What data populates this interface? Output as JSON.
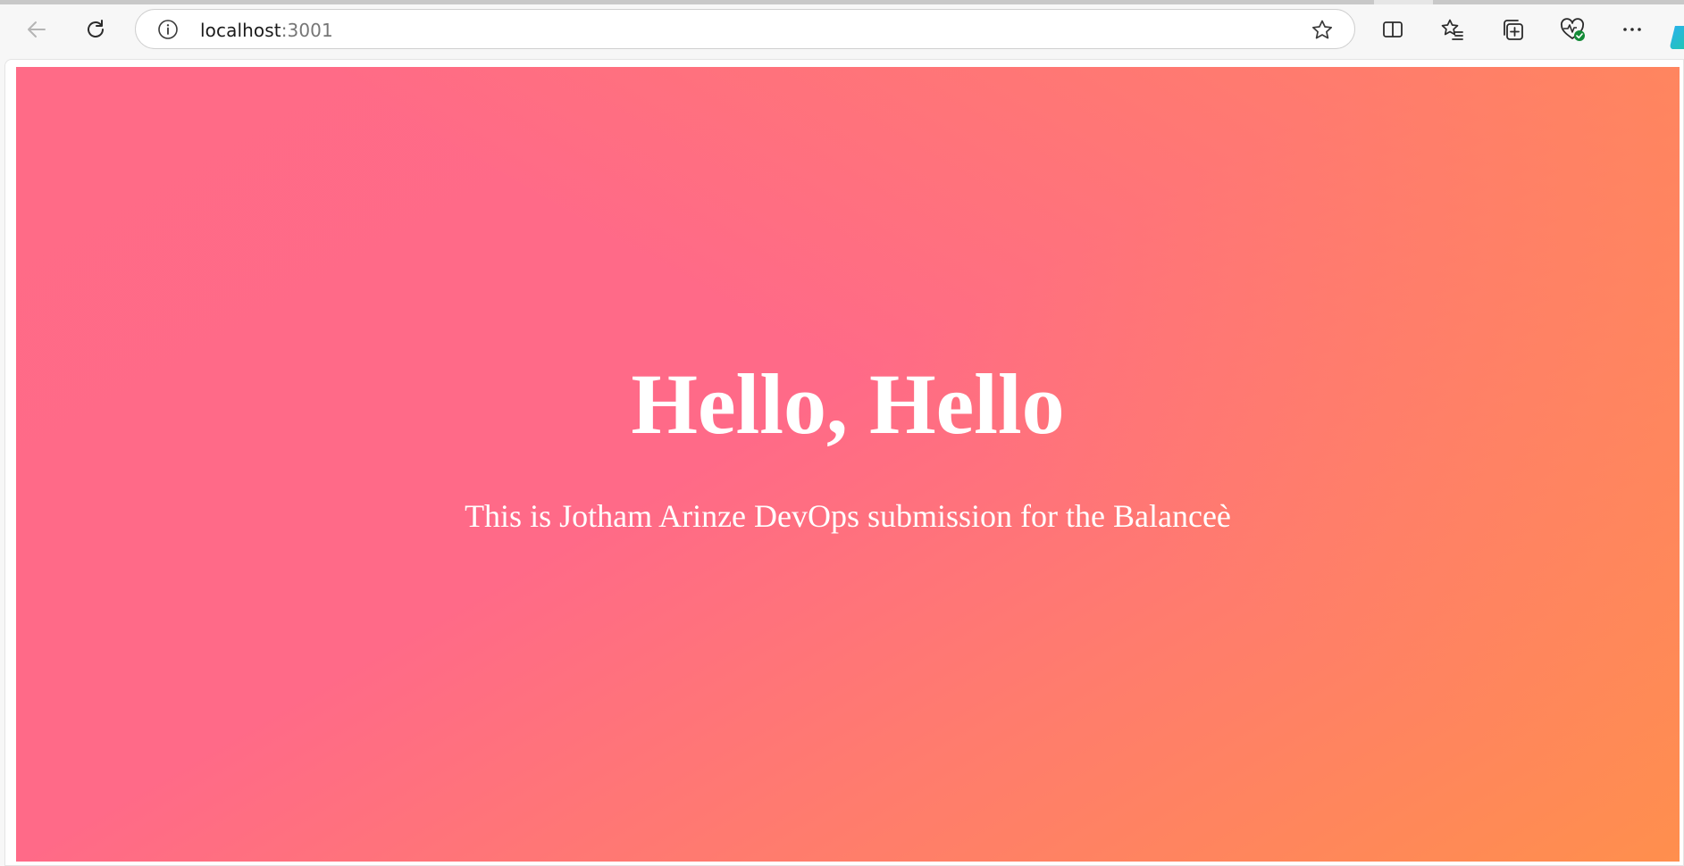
{
  "browser": {
    "address": {
      "host": "localhost",
      "port": ":3001"
    },
    "icons": {
      "back": "back-arrow-icon",
      "reload": "reload-icon",
      "info": "info-icon",
      "favorite": "star-icon",
      "split_screen": "split-screen-icon",
      "favorites": "favorites-icon",
      "collections": "collections-icon",
      "browser_essentials": "heart-pulse-icon",
      "menu": "more-icon",
      "copilot": "copilot-icon"
    }
  },
  "page": {
    "title": "Hello, Hello",
    "subtitle": "This is Jotham Arinze DevOps submission for the Balanceè",
    "colors": {
      "gradient_start": "#ff6a88",
      "gradient_end": "#ff8f4d",
      "text": "#ffffff"
    }
  }
}
